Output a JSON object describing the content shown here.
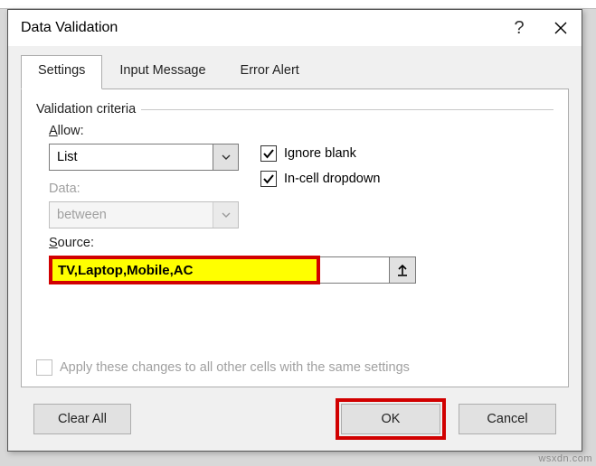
{
  "dialog": {
    "title": "Data Validation",
    "help": "?",
    "close": "×"
  },
  "tabs": {
    "settings": "Settings",
    "input_message": "Input Message",
    "error_alert": "Error Alert"
  },
  "fieldset": {
    "legend": "Validation criteria"
  },
  "allow": {
    "label_pre": "A",
    "label_post": "llow:",
    "value": "List"
  },
  "data": {
    "label_pre": "D",
    "label_post": "ata:",
    "value": "between"
  },
  "checks": {
    "ignore_pre": "Ignore ",
    "ignore_u": "b",
    "ignore_post": "lank",
    "incell_u": "I",
    "incell_post": "n-cell dropdown"
  },
  "source": {
    "label_u": "S",
    "label_post": "ource:",
    "value": "TV,Laptop,Mobile,AC"
  },
  "apply": {
    "label_pre": "Apply these changes to all other cells with the same settings",
    "label_u": "P"
  },
  "footer": {
    "clear_u": "C",
    "clear_post": "lear All",
    "ok": "OK",
    "cancel": "Cancel"
  },
  "watermark": "wsxdn.com"
}
